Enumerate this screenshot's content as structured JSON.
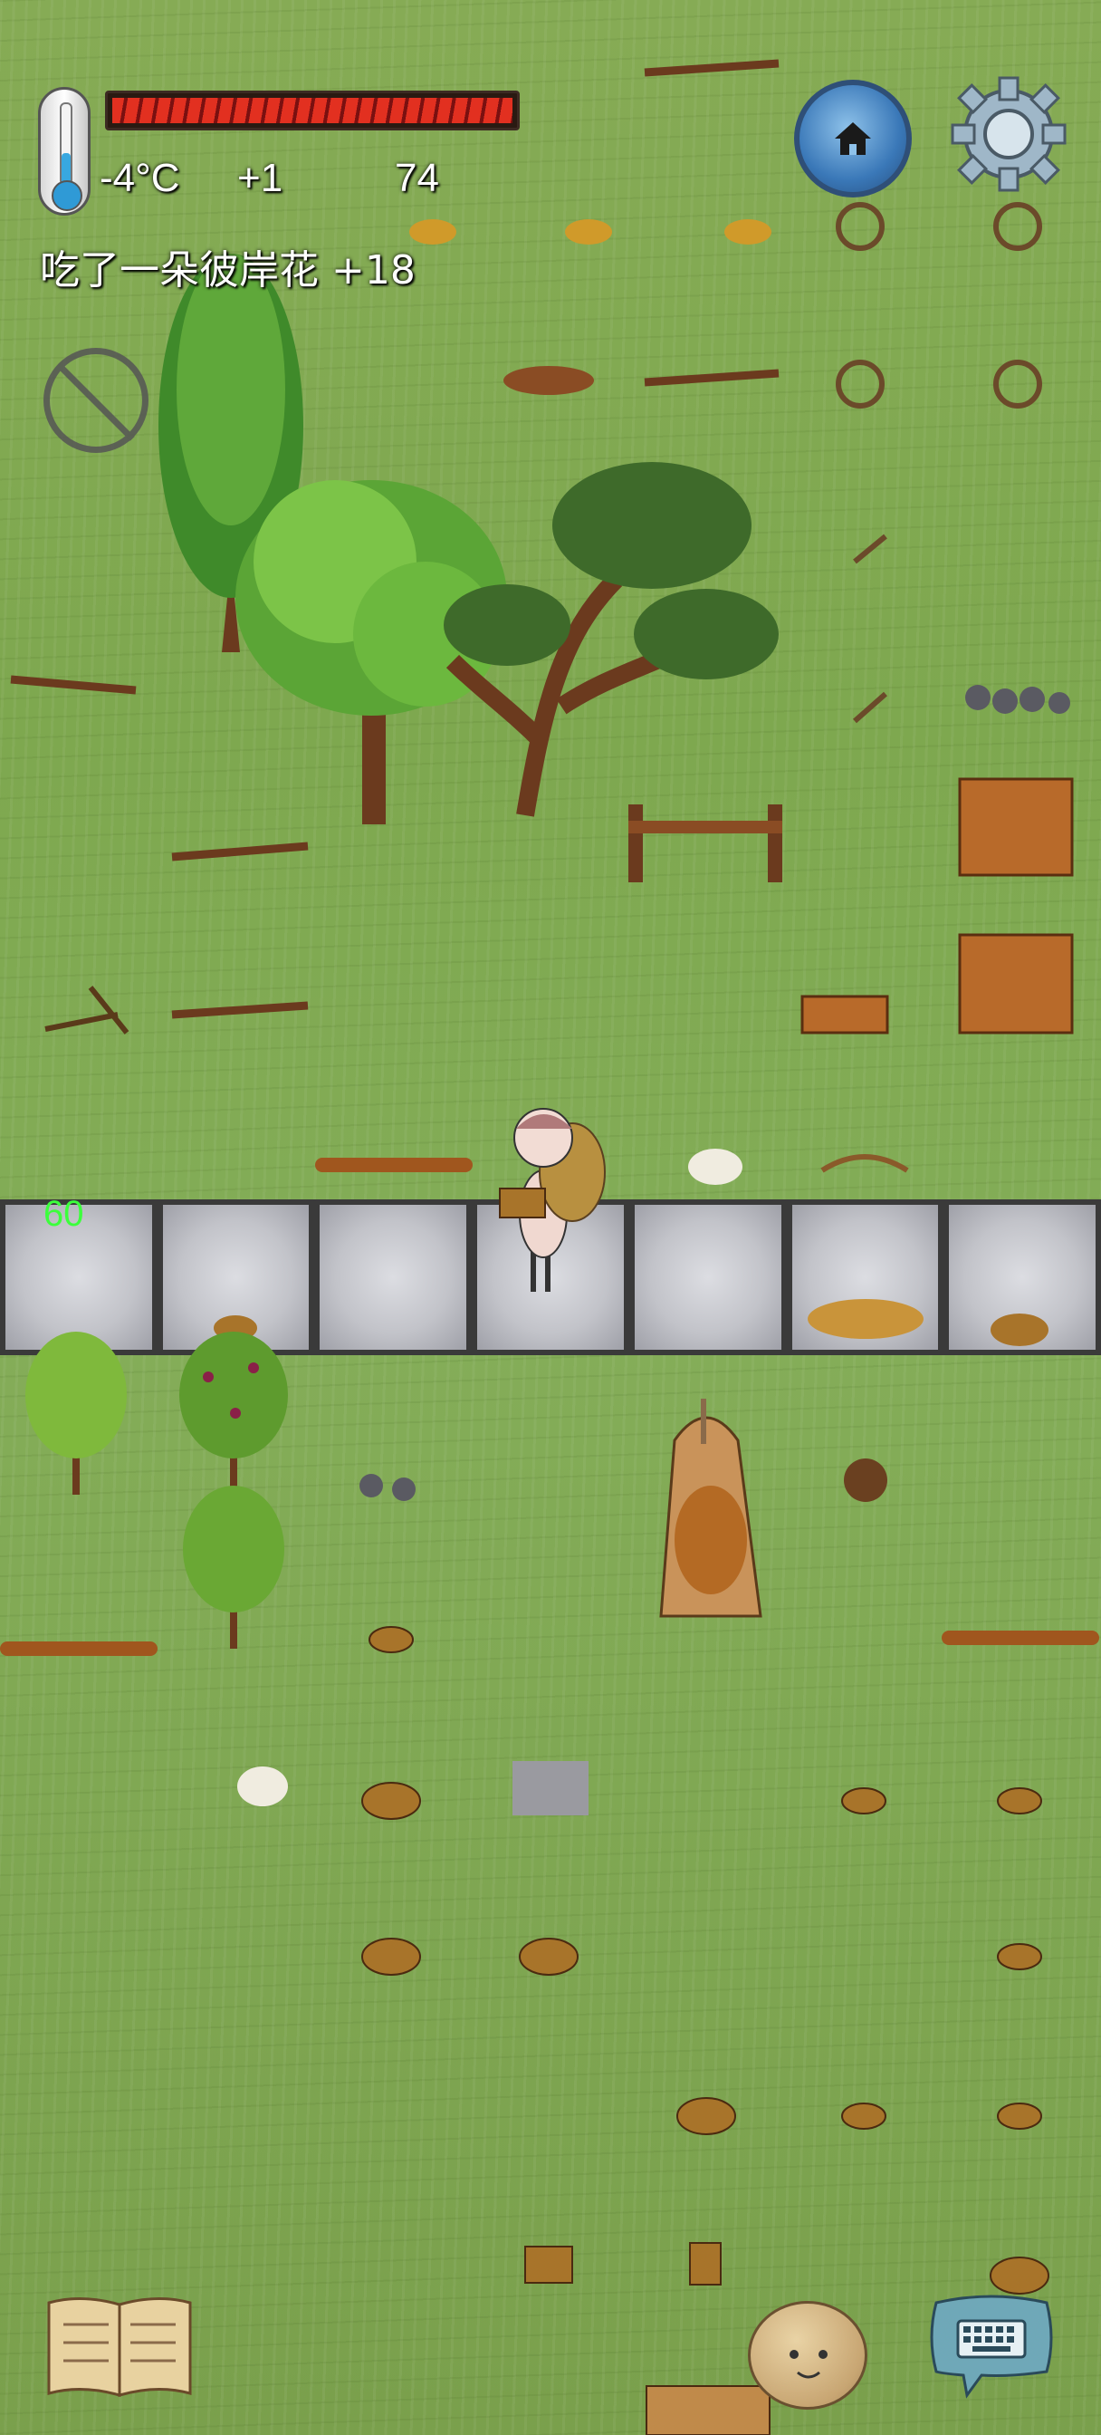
{
  "hud": {
    "temperature": "-4°C",
    "temperature_delta": "+1",
    "food_value": "74",
    "status_message": "吃了一朵彼岸花 +18",
    "health_fraction": 1.0,
    "fps_counter": "60"
  },
  "icons": {
    "thermometer": "thermometer-icon",
    "home": "home-icon",
    "settings": "gear-icon",
    "no_bugs": "no-bug-icon",
    "recipe_book": "book-icon",
    "emote": "face-icon",
    "keyboard": "keyboard-icon"
  },
  "colors": {
    "grass": "#7ea84f",
    "health_bar": "#e23020",
    "fps_text": "#3cff3c",
    "stone_floor": "#c2c3c9",
    "home_button": "#3a78b8"
  }
}
